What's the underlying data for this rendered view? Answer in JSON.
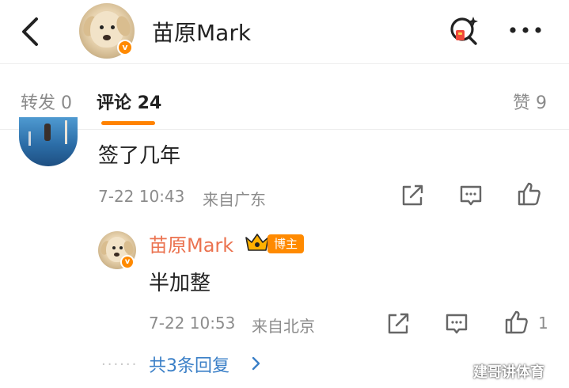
{
  "header": {
    "title": "苗原Mark",
    "back_icon": "chevron-left-icon",
    "search_icon": "search-sparkle-icon",
    "more_icon": "more-horizontal-icon",
    "verified_badge": "v"
  },
  "tabs": [
    {
      "label": "转发 0",
      "active": false
    },
    {
      "label": "评论 24",
      "active": true
    },
    {
      "label": "赞 9",
      "active": false
    }
  ],
  "accent_color": "#ff8200",
  "comment": {
    "text": "签了几年",
    "time": "7-22 10:43",
    "location": "来自广东"
  },
  "reply": {
    "author": "苗原Mark",
    "badge": "博主",
    "verified_badge": "v",
    "text": "半加整",
    "time": "7-22 10:53",
    "location": "来自北京",
    "like_count": "1"
  },
  "more_replies": {
    "dots": "······",
    "label": "共3条回复"
  },
  "watermark": "建哥讲体育"
}
